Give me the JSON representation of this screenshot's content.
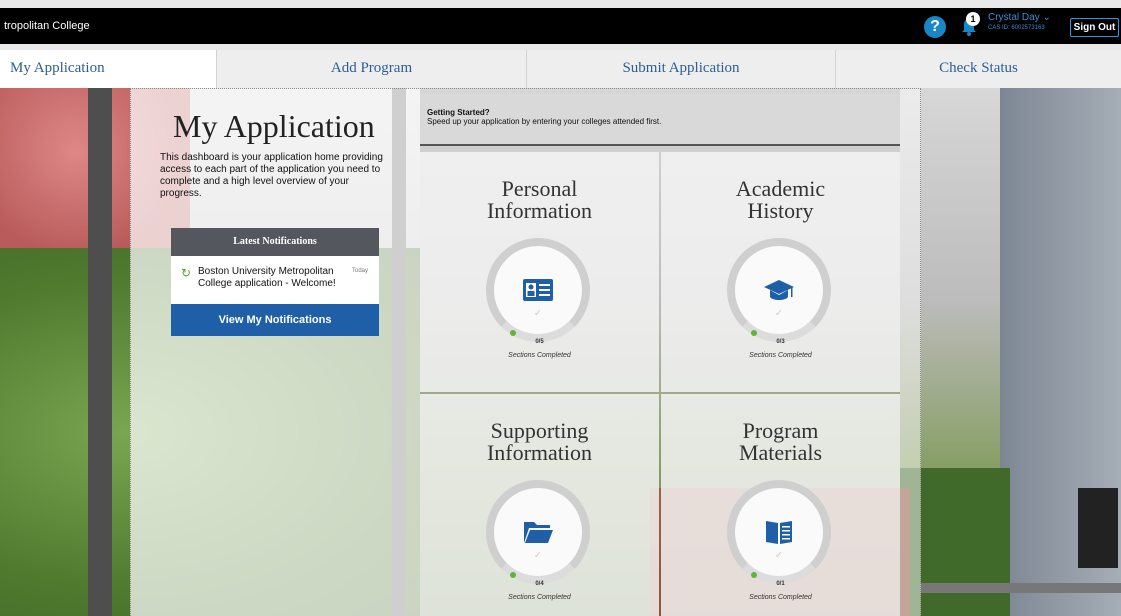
{
  "header": {
    "brand": "tropolitan College",
    "help_icon": "?",
    "notification_count": "1",
    "user_name": "Crystal Day ⌄",
    "cas_id": "CAS ID: 6002573163",
    "signout_label": "Sign Out"
  },
  "nav": {
    "tabs": [
      {
        "label": "My Application"
      },
      {
        "label": "Add Program"
      },
      {
        "label": "Submit Application"
      },
      {
        "label": "Check Status"
      }
    ]
  },
  "main": {
    "title": "My Application",
    "description": "This dashboard is your application home providing access to each part of the application you need to complete and a high level overview of your progress.",
    "notifications": {
      "heading": "Latest Notifications",
      "items": [
        {
          "text": "Boston University Metropolitan College application - Welcome!",
          "time": "Today"
        }
      ],
      "button_label": "View My Notifications"
    },
    "getting_started": {
      "heading": "Getting Started?",
      "text": "Speed up your application by entering your colleges attended first."
    },
    "sections": [
      {
        "title_line1": "Personal",
        "title_line2": "Information",
        "count": "0/5",
        "label": "Sections Completed",
        "icon": "id-card-icon"
      },
      {
        "title_line1": "Academic",
        "title_line2": "History",
        "count": "0/3",
        "label": "Sections Completed",
        "icon": "graduation-cap-icon"
      },
      {
        "title_line1": "Supporting",
        "title_line2": "Information",
        "count": "0/4",
        "label": "Sections Completed",
        "icon": "folder-icon"
      },
      {
        "title_line1": "Program",
        "title_line2": "Materials",
        "count": "0/1",
        "label": "Sections Completed",
        "icon": "book-icon"
      }
    ]
  },
  "colors": {
    "accent_blue": "#1f5fa8",
    "link_blue": "#2b5f93",
    "progress_green": "#61b33c"
  }
}
